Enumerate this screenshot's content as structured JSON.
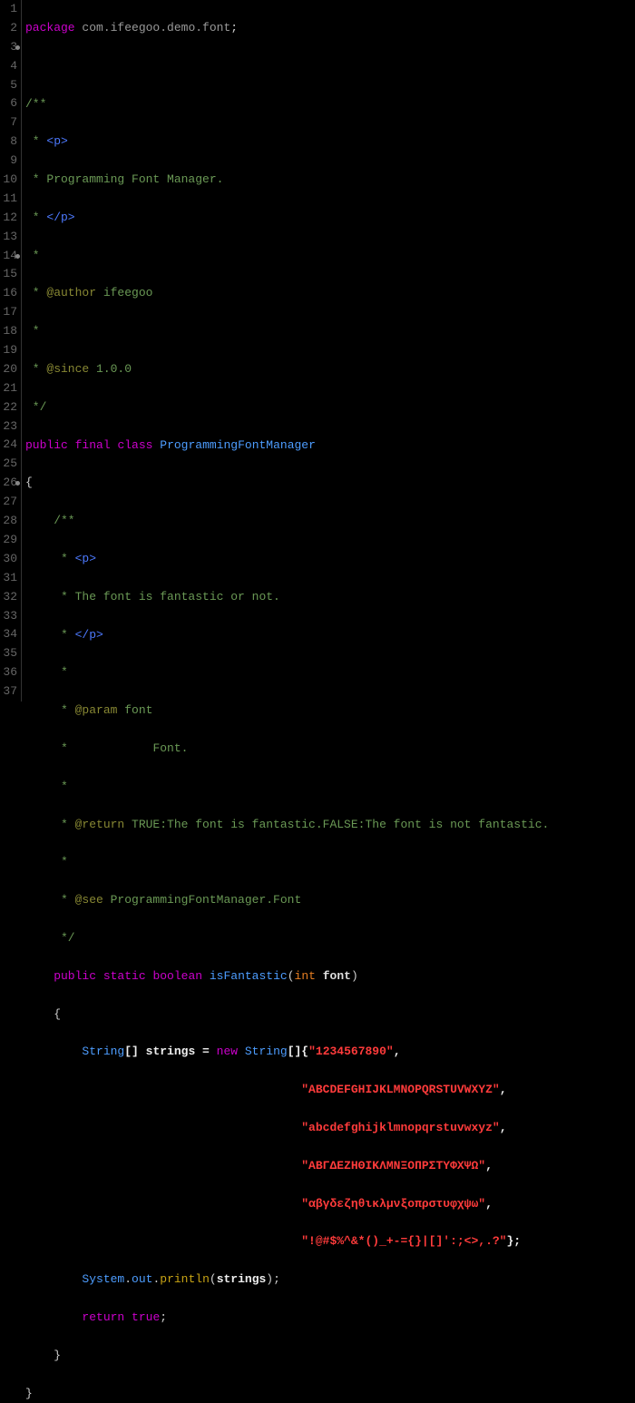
{
  "lines": {
    "1": {
      "package_kw": "package",
      "package_name": "com.ifeegoo.demo.font",
      "semi": ";"
    },
    "3": {
      "doc_open": "/**"
    },
    "4": {
      "star": " * ",
      "tag": "<p>"
    },
    "5": {
      "star": " * ",
      "text": "Programming Font Manager."
    },
    "6": {
      "star": " * ",
      "tag": "</p>"
    },
    "7": {
      "star": " *"
    },
    "8": {
      "star": " * ",
      "tag": "@author",
      "text": " ifeegoo"
    },
    "9": {
      "star": " *"
    },
    "10": {
      "star": " * ",
      "tag": "@since",
      "text": " 1.0.0"
    },
    "11": {
      "doc_close": " */"
    },
    "12": {
      "public": "public",
      "final": "final",
      "class": "class",
      "name": "ProgrammingFontManager"
    },
    "13": {
      "brace": "{"
    },
    "14": {
      "doc_open": "    /**"
    },
    "15": {
      "star": "     * ",
      "tag": "<p>"
    },
    "16": {
      "star": "     * ",
      "text": "The font is fantastic or not."
    },
    "17": {
      "star": "     * ",
      "tag": "</p>"
    },
    "18": {
      "star": "     *"
    },
    "19": {
      "star": "     * ",
      "tag": "@param",
      "text": " font"
    },
    "20": {
      "star": "     *            ",
      "text": "Font."
    },
    "21": {
      "star": "     *"
    },
    "22": {
      "star": "     * ",
      "tag": "@return",
      "text": " TRUE:The font is fantastic.FALSE:The font is not fantastic."
    },
    "23": {
      "star": "     *"
    },
    "24": {
      "star": "     * ",
      "tag": "@see",
      "text": " ProgrammingFontManager.Font"
    },
    "25": {
      "star": "     */"
    },
    "26": {
      "public": "    public",
      "static": "static",
      "ret": "boolean",
      "name": "isFantastic",
      "lp": "(",
      "ptype": "int",
      "pname": "font",
      "rp": ")"
    },
    "27": {
      "brace": "    {"
    },
    "28": {
      "ind": "        ",
      "type": "String",
      "arr": "[] ",
      "var": "strings",
      "eq": " = ",
      "new": "new",
      "type2": "String",
      "arr2": "[]{",
      "str": "\"1234567890\"",
      "comma": ","
    },
    "29": {
      "ind": "                                       ",
      "str": "\"ABCDEFGHIJKLMNOPQRSTUVWXYZ\"",
      "comma": ","
    },
    "30": {
      "ind": "                                       ",
      "str": "\"abcdefghijklmnopqrstuvwxyz\"",
      "comma": ","
    },
    "31": {
      "ind": "                                       ",
      "str": "\"ΑΒΓΔΕΖΗΘΙΚΛΜΝΞΟΠΡΣΤΥΦΧΨΩ\"",
      "comma": ","
    },
    "32": {
      "ind": "                                       ",
      "str": "\"αβγδεζηθικλμνξοπρστυφχψω\"",
      "comma": ","
    },
    "33": {
      "ind": "                                       ",
      "str": "\"!@#$%^&*()_+-={}|[]':;<>,.?\"",
      "end": "};"
    },
    "34": {
      "ind": "        ",
      "sys": "System",
      "dot1": ".",
      "out": "out",
      "dot2": ".",
      "println": "println",
      "lp": "(",
      "arg": "strings",
      "rp": ");"
    },
    "35": {
      "ind": "        ",
      "return": "return",
      "val": "true",
      "semi": ";"
    },
    "36": {
      "brace": "    }"
    },
    "37": {
      "brace": "}"
    }
  },
  "line_count": 37,
  "fold_lines": [
    3,
    14,
    26
  ]
}
